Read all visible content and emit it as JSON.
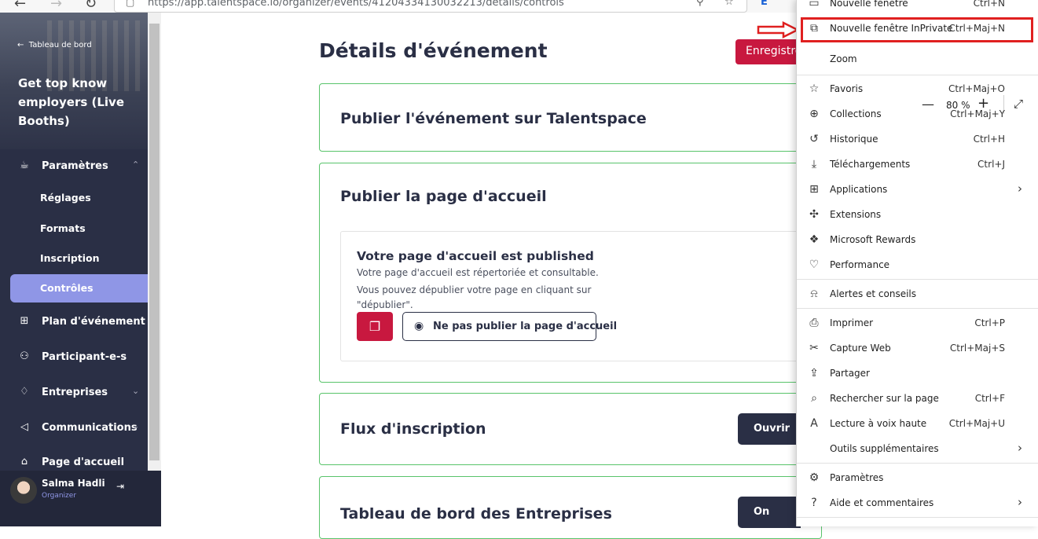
{
  "browser": {
    "url": "https://app.talentspace.io/organizer/events/41204334130032213/details/controls",
    "back_icon": "back-arrow-icon",
    "forward_icon": "forward-arrow-icon",
    "refresh_icon": "refresh-icon"
  },
  "sidebar": {
    "back_label": "Tableau de bord",
    "event_title": "Get top know employers (Live Booths)",
    "params_label": "Paramètres",
    "sub_items": [
      {
        "label": "Réglages"
      },
      {
        "label": "Formats"
      },
      {
        "label": "Inscription"
      },
      {
        "label": "Contrôles",
        "active": true
      }
    ],
    "items": [
      {
        "label": "Plan d'événement",
        "icon": "floorplan-icon"
      },
      {
        "label": "Participant-e-s",
        "icon": "person-icon"
      },
      {
        "label": "Entreprises",
        "icon": "handshake-icon"
      },
      {
        "label": "Communications",
        "icon": "megaphone-icon"
      },
      {
        "label": "Page d'accueil",
        "icon": "home-icon"
      }
    ],
    "user": {
      "name": "Salma Hadli",
      "role": "Organizer"
    }
  },
  "main": {
    "title": "Détails d'événement",
    "save_label": "Enregistrer",
    "cards": {
      "publish_event": "Publier l'événement sur Talentspace",
      "publish_home": "Publier la page d'accueil",
      "published_heading": "Votre page d'accueil est published",
      "published_line1": "Votre page d'accueil est répertoriée et consultable.",
      "published_line2": "Vous pouvez dépublier votre page en cliquant sur \"dépublier\".",
      "unpublish_label": "Ne pas publier la page d'accueil",
      "registration_flow": "Flux d'inscription",
      "open_label": "Ouvrir",
      "company_dashboard": "Tableau de bord des Entreprises",
      "on_label": "On"
    }
  },
  "menu": {
    "new_window": {
      "label": "Nouvelle fenêtre",
      "shortcut": "Ctrl+N"
    },
    "inprivate": {
      "label": "Nouvelle fenêtre InPrivate",
      "shortcut": "Ctrl+Maj+N"
    },
    "zoom": {
      "label": "Zoom",
      "value": "80 %",
      "minus": "—",
      "plus": "+"
    },
    "items": [
      {
        "label": "Favoris",
        "shortcut": "Ctrl+Maj+O"
      },
      {
        "label": "Collections",
        "shortcut": "Ctrl+Maj+Y"
      },
      {
        "label": "Historique",
        "shortcut": "Ctrl+H"
      },
      {
        "label": "Téléchargements",
        "shortcut": "Ctrl+J"
      },
      {
        "label": "Applications",
        "shortcut": ""
      },
      {
        "label": "Extensions",
        "shortcut": ""
      },
      {
        "label": "Microsoft Rewards",
        "shortcut": ""
      },
      {
        "label": "Performance",
        "shortcut": ""
      },
      {
        "label": "Alertes et conseils",
        "shortcut": ""
      },
      {
        "label": "Imprimer",
        "shortcut": "Ctrl+P"
      },
      {
        "label": "Capture Web",
        "shortcut": "Ctrl+Maj+S"
      },
      {
        "label": "Partager",
        "shortcut": ""
      },
      {
        "label": "Rechercher sur la page",
        "shortcut": "Ctrl+F"
      },
      {
        "label": "Lecture à voix haute",
        "shortcut": "Ctrl+Maj+U"
      },
      {
        "label": "Outils supplémentaires",
        "shortcut": ""
      },
      {
        "label": "Paramètres",
        "shortcut": ""
      },
      {
        "label": "Aide et commentaires",
        "shortcut": ""
      }
    ]
  },
  "colors": {
    "accent": "#c8183f",
    "sidebar": "#2a2f45",
    "active": "#8f96e6",
    "card_border": "#59c46b",
    "highlight": "#e02020"
  }
}
